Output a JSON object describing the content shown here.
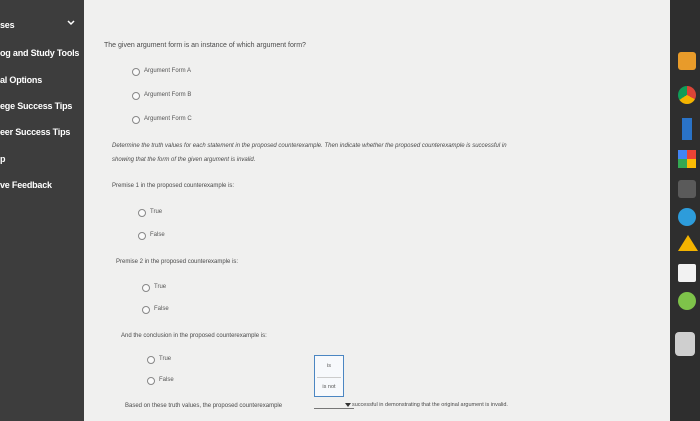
{
  "sidebar": {
    "items": [
      {
        "label": "ses"
      },
      {
        "label": "og and Study Tools"
      },
      {
        "label": "al Options"
      },
      {
        "label": "ege Success Tips"
      },
      {
        "label": "eer Success Tips"
      },
      {
        "label": "p"
      },
      {
        "label": "ve Feedback"
      }
    ]
  },
  "main": {
    "question": "The given argument form is an instance of which argument form?",
    "options": [
      "Argument Form A",
      "Argument Form B",
      "Argument Form C"
    ],
    "instructions_1": "Determine the truth values for each statement in the proposed counterexample. Then indicate whether the proposed counterexample is successful in",
    "instructions_2": "showing that the form of the given argument is invalid.",
    "premise1": {
      "label": "Premise 1 in the proposed counterexample is:",
      "true": "True",
      "false": "False"
    },
    "premise2": {
      "label": "Premise 2 in the proposed counterexample is:",
      "true": "True",
      "false": "False"
    },
    "conclusion": {
      "label": "And the conclusion in the proposed counterexample is:",
      "true": "True",
      "false": "False"
    },
    "final_prefix": "Based on these truth values, the proposed counterexample",
    "final_suffix": "successful in demonstrating that the original argument is invalid.",
    "dropdown_options": [
      "is",
      "is not"
    ]
  },
  "colors": {
    "sidebar": "#3d3d3d",
    "content": "#f0f0ef",
    "dropdown_border": "#4b86c2"
  },
  "right_icons": [
    "orange-app-icon",
    "chrome-icon",
    "blue-app-icon",
    "google-photos-icon",
    "drive-icon",
    "docs-icon",
    "files-icon",
    "camera-icon",
    "system-icon"
  ]
}
